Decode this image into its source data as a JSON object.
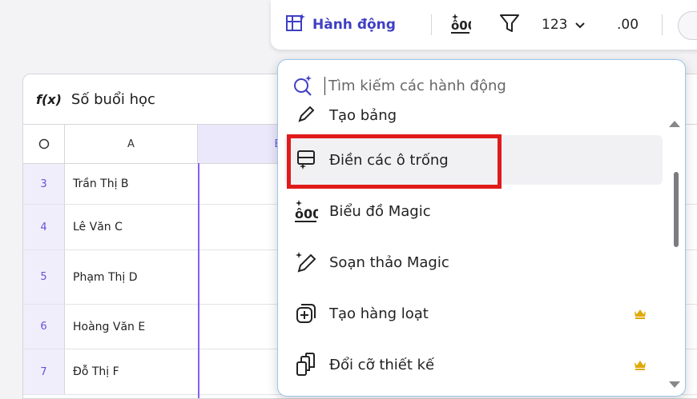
{
  "toolbar": {
    "actions_label": "Hành động",
    "number_format": "123",
    "decimal_format": ".00"
  },
  "formula_bar": {
    "fx_label": "f(x)",
    "value": "Số buổi học"
  },
  "columns": {
    "A": "A",
    "B": "B"
  },
  "rows": [
    {
      "num": "3",
      "name": "Trần Thị B"
    },
    {
      "num": "4",
      "name": "Lê Văn C"
    },
    {
      "num": "5",
      "name": "Phạm Thị D"
    },
    {
      "num": "6",
      "name": "Hoàng Văn E"
    },
    {
      "num": "7",
      "name": "Đỗ Thị F"
    }
  ],
  "dropdown": {
    "search_placeholder": "Tìm kiếm các hành động",
    "partial_item": "Tạo bảng",
    "items": [
      {
        "label": "Điền các ô trống",
        "icon": "fill-cells-icon",
        "premium": false
      },
      {
        "label": "Biểu đồ Magic",
        "icon": "magic-chart-icon",
        "premium": false
      },
      {
        "label": "Soạn thảo Magic",
        "icon": "magic-write-icon",
        "premium": false
      },
      {
        "label": "Tạo hàng loạt",
        "icon": "bulk-create-icon",
        "premium": true
      },
      {
        "label": "Đổi cỡ thiết kế",
        "icon": "resize-icon",
        "premium": true
      }
    ]
  },
  "colors": {
    "accent": "#3f3fc4",
    "highlight": "#e01b1b",
    "crown": "#e0a800"
  }
}
